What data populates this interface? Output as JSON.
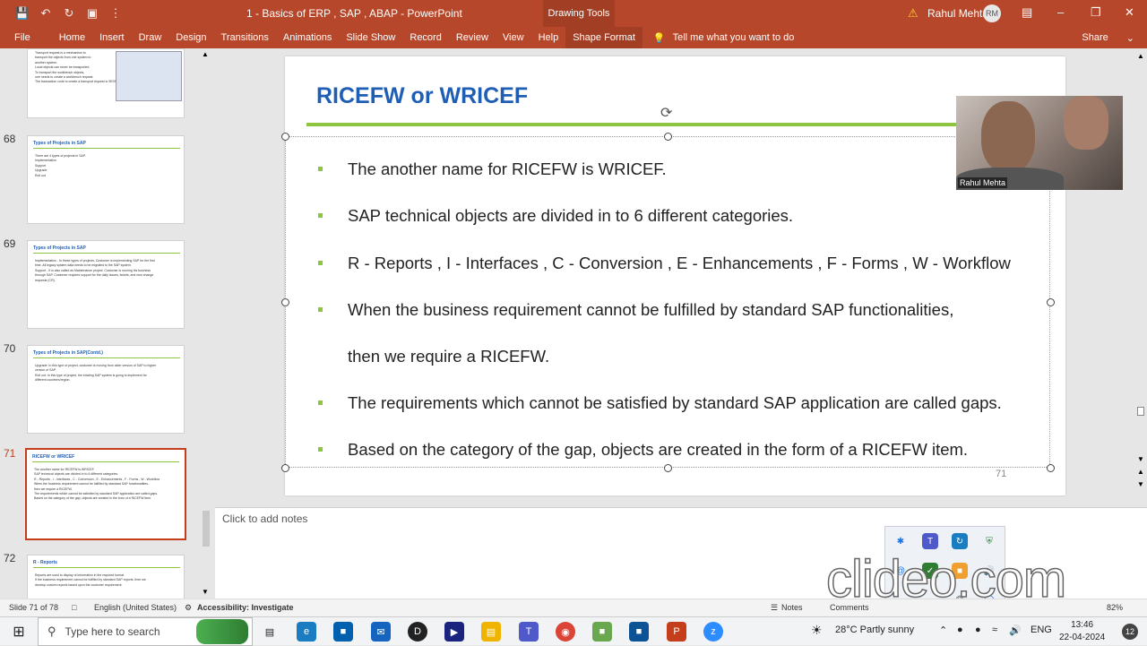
{
  "window": {
    "title": "1 - Basics of ERP , SAP , ABAP  -  PowerPoint",
    "context_tab": "Drawing Tools",
    "user_name": "Rahul Mehta",
    "user_initials": "RM"
  },
  "qat": {
    "save_icon": "save-icon",
    "undo_icon": "undo-icon",
    "redo_icon": "redo-icon",
    "present_icon": "present-icon"
  },
  "ribbon": {
    "tabs": [
      "File",
      "Home",
      "Insert",
      "Draw",
      "Design",
      "Transitions",
      "Animations",
      "Slide Show",
      "Record",
      "Review",
      "View",
      "Help",
      "Shape Format"
    ],
    "tell_me": "Tell me what you want to do",
    "share": "Share"
  },
  "thumbnails": [
    {
      "num": "",
      "title": "",
      "lines": [
        "Transport request is a mechanism to",
        "transport the objects from one system to",
        "another system.",
        "Local objects can never be transported.",
        "To transport the workbench objects,",
        "one needs to create a workbench request.",
        "The transaction code to create a transport request is SE09."
      ]
    },
    {
      "num": "68",
      "title": "Types of Projects in SAP",
      "lines": [
        "There are 4 types of projects in SAP.",
        "Implementation",
        "Support",
        "Upgrade",
        "Roll out"
      ]
    },
    {
      "num": "69",
      "title": "Types of Projects in SAP",
      "lines": [
        "Implementation - In these types of projects, Customer is implementing SAP for the first",
        "time. All legacy system data needs to be migrated to the SAP system.",
        "Support - It is also called as Maintenance project. Customer is running his business",
        "through SAP. Customer requires support for the daily issues, tickets, and new change",
        "requests (CR)."
      ]
    },
    {
      "num": "70",
      "title": "Types of Projects in SAP(Contd.)",
      "lines": [
        "Upgrade: In this type of project, customer is moving from older version of SAP to higher",
        "version of SAP.",
        "Roll out: In this type of project, the existing SAP system is going to implement for",
        "different countries/region."
      ]
    },
    {
      "num": "71",
      "title": "RICEFW or WRICEF",
      "lines": [
        "The another name for RICEFW is WRICEF.",
        "SAP technical objects are divided in to 6 different categories.",
        "R - Reports , I - Interfaces , C - Conversion , E - Enhancements , F - Forms , W - Workflow",
        "When the business requirement cannot be fulfilled by standard SAP functionalities,",
        "then we require a RICEFW.",
        "The requirements which cannot be satisfied by standard SAP application are called gaps.",
        "Based on the category of the gap, objects are created in the form of a RICEFW item."
      ]
    },
    {
      "num": "72",
      "title": "R - Reports",
      "lines": [
        "Reports are used to display of information in the required format.",
        "If the business requirement cannot be fulfilled by standard SAP reports, then we",
        "develop custom reports based upon the customer requirement."
      ]
    }
  ],
  "slide": {
    "title": "RICEFW or WRICEF",
    "bullets": [
      "The another name for RICEFW is WRICEF.",
      "SAP technical objects are divided in to 6 different categories.",
      "R - Reports , I - Interfaces ,  C - Conversion , E - Enhancements , F - Forms , W - Workflow",
      "When the business requirement cannot be fulfilled by standard SAP functionalities,",
      "then we require a RICEFW.",
      "The requirements which cannot be satisfied by standard SAP application are called gaps.",
      "Based on the category of the gap, objects are created in the form of a RICEFW item."
    ],
    "slide_number": "71"
  },
  "video": {
    "name": "Rahul Mehta"
  },
  "notes": {
    "placeholder": "Click to add notes"
  },
  "watermark": "clideo.com",
  "statusbar": {
    "slide_info": "Slide 71 of 78",
    "language": "English (United States)",
    "accessibility": "Accessibility: Investigate",
    "notes": "Notes",
    "comments": "Comments",
    "zoom": "82%"
  },
  "taskbar": {
    "search_placeholder": "Type here to search",
    "weather": "28°C  Partly sunny",
    "lang": "ENG",
    "time": "13:46",
    "date": "22-04-2024",
    "notification_count": "12"
  },
  "colors": {
    "accent": "#b7472a",
    "title_blue": "#1f5eb5",
    "line_green": "#8cc640"
  }
}
